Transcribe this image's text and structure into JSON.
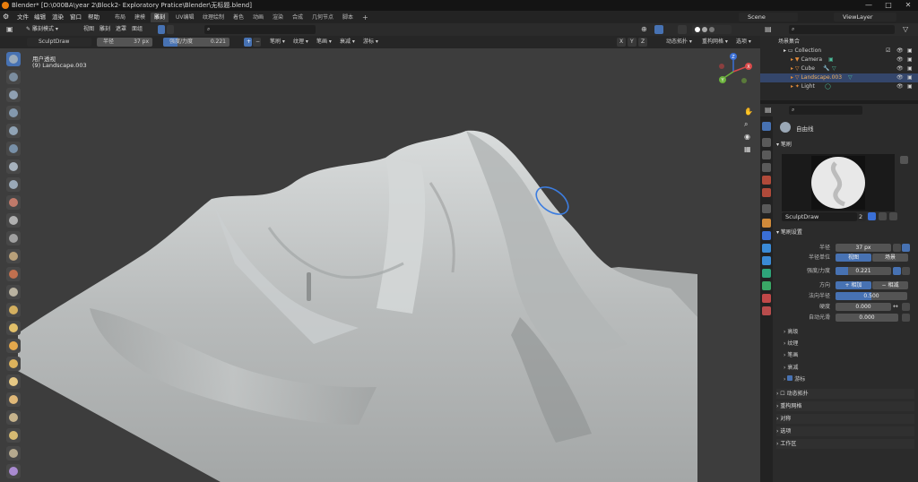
{
  "titlebar": {
    "title": "Blender* [D:\\000BA\\year 2\\Block2- Exploratory Pratice\\Blender\\无标题.blend]",
    "min": "—",
    "max": "□",
    "close": "✕"
  },
  "menubar": {
    "menus": [
      "文件",
      "编辑",
      "渲染",
      "窗口",
      "帮助"
    ],
    "workspaces": [
      "布局",
      "建模",
      "雕刻",
      "UV编辑",
      "纹理绘制",
      "着色",
      "动画",
      "渲染",
      "合成",
      "几何节点",
      "脚本"
    ],
    "active_workspace": "雕刻",
    "add_tab": "+",
    "scene": "Scene",
    "view_layer": "ViewLayer"
  },
  "viewport_header": {
    "mode": "雕刻模式",
    "menus": [
      "视图",
      "雕刻",
      "遮罩",
      "面组"
    ],
    "brush_name": "SculptDraw",
    "radius_label": "半径",
    "radius_value": "37 px",
    "strength_label": "强度/力度",
    "strength_value": "0.221",
    "dropdowns": [
      "笔刷",
      "纹理",
      "笔画",
      "衰减",
      "游标"
    ],
    "axes": [
      "X",
      "Y",
      "Z"
    ],
    "dyntopo": "动态拓扑",
    "remesh": "重构网格",
    "options": "选项"
  },
  "viewport": {
    "view_name": "用户透视",
    "object_label": "(9) Landscape.003",
    "gizmo_axes": [
      "X",
      "Y",
      "Z"
    ]
  },
  "outliner": {
    "title": "场景集合",
    "rows": [
      {
        "name": "Collection",
        "icon": "collection-icon"
      },
      {
        "name": "Camera",
        "icon": "camera-icon"
      },
      {
        "name": "Cube",
        "icon": "mesh-icon"
      },
      {
        "name": "Landscape.003",
        "icon": "mesh-icon"
      },
      {
        "name": "Light",
        "icon": "light-icon"
      }
    ]
  },
  "properties": {
    "tool_name": "自由线",
    "brush_panel": "笔刷",
    "brush_name": "SculptDraw",
    "brush_users": "2",
    "brush_settings": "笔刷设置",
    "radius_label": "半径",
    "radius_value": "37 px",
    "radius_unit_label": "半径单位",
    "radius_unit_view": "视图",
    "radius_unit_scene": "场景",
    "strength_label": "强度/力度",
    "strength_value": "0.221",
    "direction_label": "方向",
    "direction_add": "相加",
    "direction_sub": "相减",
    "normal_radius_label": "法向半径",
    "normal_radius_value": "0.500",
    "hardness_label": "硬度",
    "hardness_value": "0.000",
    "autosmooth_label": "自动光滑",
    "autosmooth_value": "0.000",
    "subpanels": [
      "高级",
      "纹理",
      "笔画",
      "衰减",
      "游标"
    ],
    "panels": [
      "动态拓扑",
      "重构网格",
      "对称",
      "选项",
      "工作区"
    ]
  },
  "colors": {
    "accent": "#4772b3",
    "blender_orange": "#e87d0d",
    "terrain": "#bfc2c2"
  }
}
